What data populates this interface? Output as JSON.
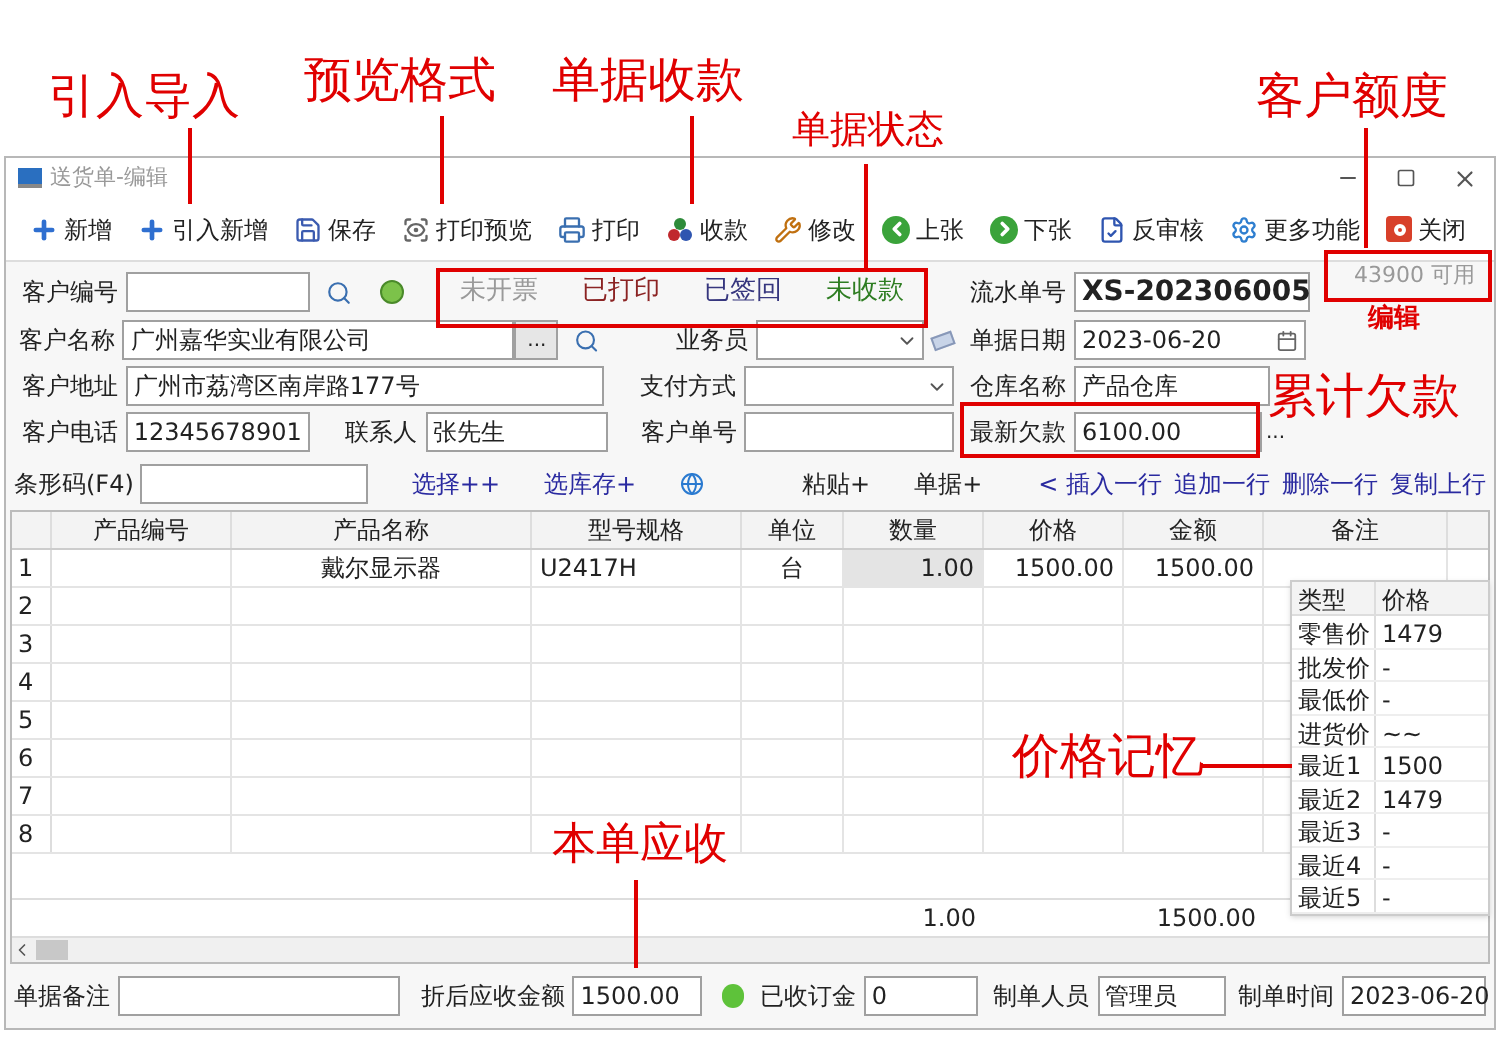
{
  "callouts": [
    {
      "text": "引入导入"
    },
    {
      "text": "预览格式"
    },
    {
      "text": "单据收款"
    },
    {
      "text": "单据状态"
    },
    {
      "text": "客户额度"
    },
    {
      "text": "编辑"
    },
    {
      "text": "累计欠款"
    },
    {
      "text": "价格记忆"
    },
    {
      "text": "本单应收"
    }
  ],
  "window": {
    "title": "送货单-编辑"
  },
  "toolbar": [
    {
      "label": "新增",
      "kind": "plus"
    },
    {
      "label": "引入新增",
      "kind": "plus"
    },
    {
      "label": "保存",
      "kind": "save"
    },
    {
      "label": "打印预览",
      "kind": "preview"
    },
    {
      "label": "打印",
      "kind": "print"
    },
    {
      "label": "收款",
      "kind": "coins"
    },
    {
      "label": "修改",
      "kind": "tools"
    },
    {
      "label": "上张",
      "kind": "prev"
    },
    {
      "label": "下张",
      "kind": "next"
    },
    {
      "label": "反审核",
      "kind": "doc"
    },
    {
      "label": "更多功能",
      "kind": "gear"
    },
    {
      "label": "关闭",
      "kind": "close"
    }
  ],
  "statuses": [
    {
      "text": "未开票",
      "color": "#9a9a9a"
    },
    {
      "text": "已打印",
      "color": "#8b2323"
    },
    {
      "text": "已签回",
      "color": "#36367e"
    },
    {
      "text": "未收款",
      "color": "#2e7d22"
    }
  ],
  "form": {
    "customer_code": {
      "label": "客户编号"
    },
    "customer_name": {
      "label": "客户名称",
      "value": "广州嘉华实业有限公司",
      "button": "..."
    },
    "customer_address": {
      "label": "客户地址",
      "value": "广州市荔湾区南岸路177号"
    },
    "customer_phone": {
      "label": "客户电话",
      "value": "12345678901"
    },
    "contact": {
      "label": "联系人",
      "value": "张先生"
    },
    "salesperson": {
      "label": "业务员"
    },
    "payment_method": {
      "label": "支付方式"
    },
    "customer_order_no": {
      "label": "客户单号"
    },
    "serial_no": {
      "label": "流水单号",
      "value": "XS-202306005"
    },
    "date": {
      "label": "单据日期",
      "value": "2023-06-20"
    },
    "warehouse": {
      "label": "仓库名称",
      "value": "产品仓库"
    },
    "latest_debt": {
      "label": "最新欠款",
      "value": "6100.00",
      "button": "..."
    },
    "credit": "43900 可用"
  },
  "barcode": {
    "label": "条形码(F4)",
    "links": [
      "选择++",
      "选库存+"
    ],
    "actions": [
      "粘贴+",
      "单据+"
    ],
    "row_links": [
      "< 插入一行",
      "追加一行",
      "删除一行",
      "复制上行"
    ]
  },
  "table": {
    "columns": [
      "产品编号",
      "产品名称",
      "型号规格",
      "单位",
      "数量",
      "价格",
      "金额",
      "备注"
    ],
    "rows": [
      {
        "number": "1",
        "selected": true,
        "product_name": "戴尔显示器",
        "model": "U2417H",
        "unit": "台",
        "quantity": "1.00",
        "price": "1500.00",
        "amount": "1500.00"
      },
      {
        "number": "2",
        "selected": false
      },
      {
        "number": "3",
        "selected": false
      },
      {
        "number": "4",
        "selected": false
      },
      {
        "number": "5",
        "selected": false
      },
      {
        "number": "6",
        "selected": false
      },
      {
        "number": "7",
        "selected": false
      },
      {
        "number": "8",
        "selected": false
      }
    ],
    "totals": {
      "quantity": "1.00",
      "amount": "1500.00"
    }
  },
  "price_memory": {
    "columns": [
      "类型",
      "价格"
    ],
    "rows": [
      [
        "零售价",
        "1479"
      ],
      [
        "批发价",
        "-"
      ],
      [
        "最低价",
        "-"
      ],
      [
        "进货价",
        "~~"
      ],
      [
        "最近1",
        "1500"
      ],
      [
        "最近2",
        "1479"
      ],
      [
        "最近3",
        "-"
      ],
      [
        "最近4",
        "-"
      ],
      [
        "最近5",
        "-"
      ]
    ]
  },
  "footer": {
    "remark": {
      "label": "单据备注"
    },
    "discounted_total": {
      "label": "折后应收金额",
      "value": "1500.00"
    },
    "deposit": {
      "label": "已收订金",
      "value": "0"
    },
    "creator": {
      "label": "制单人员",
      "value": "管理员"
    },
    "created_time": {
      "label": "制单时间",
      "value": "2023-06-20"
    }
  }
}
